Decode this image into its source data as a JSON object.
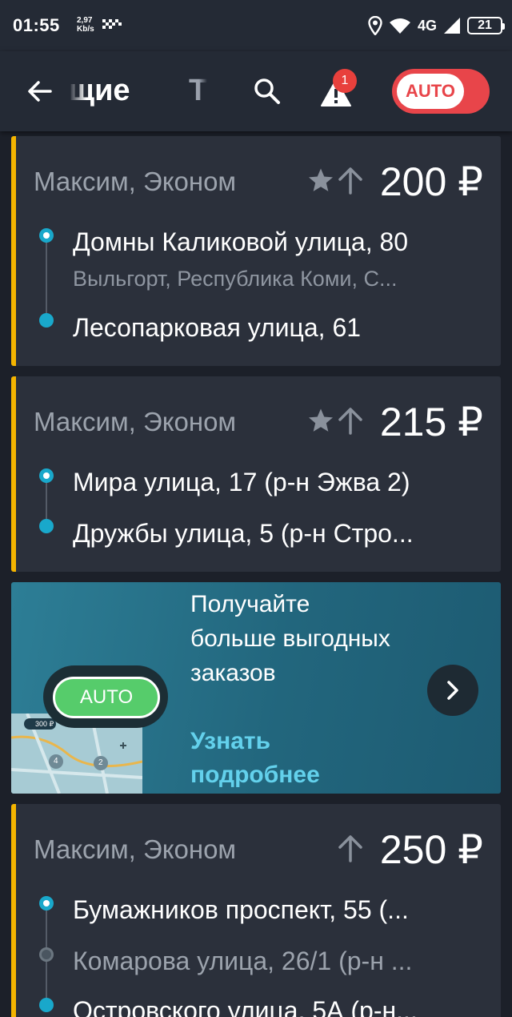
{
  "status_bar": {
    "time": "01:55",
    "speed_value": "2,97",
    "speed_unit": "Kb/s",
    "network": "4G",
    "battery": "21"
  },
  "toolbar": {
    "tab_active": "щие",
    "tab_next": "Т",
    "alert_count": "1",
    "auto_label": "AUTO"
  },
  "orders": [
    {
      "client": "Максим, Эконом",
      "price": "200 ₽",
      "from": "Домны Каликовой улица, 80",
      "from_sub": "Выльгорт, Республика Коми, С...",
      "to": "Лесопарковая улица, 61"
    },
    {
      "client": "Максим, Эконом",
      "price": "215 ₽",
      "from": "Мира улица, 17 (р-н Эжва 2)",
      "to": "Дружбы улица, 5 (р-н Стро..."
    },
    {
      "client": "Максим, Эконом",
      "price": "250 ₽",
      "from": "Бумажников проспект, 55 (...",
      "stop": "Комарова улица, 26/1 (р-н ...",
      "to": "Островского улица, 5А (р-н..."
    }
  ],
  "promo": {
    "auto_label": "AUTO",
    "map_price": "300 ₽",
    "map_marker_1": "4",
    "map_marker_2": "2",
    "text": "Получайте больше выгодных заказов",
    "link": "Узнать подробнее"
  },
  "colors": {
    "background": "#1c2029",
    "card": "#2b303b",
    "accent_yellow": "#f4b400",
    "auto_red": "#e8454a",
    "route_blue": "#19a8cb",
    "promo_link": "#63d1ec"
  }
}
